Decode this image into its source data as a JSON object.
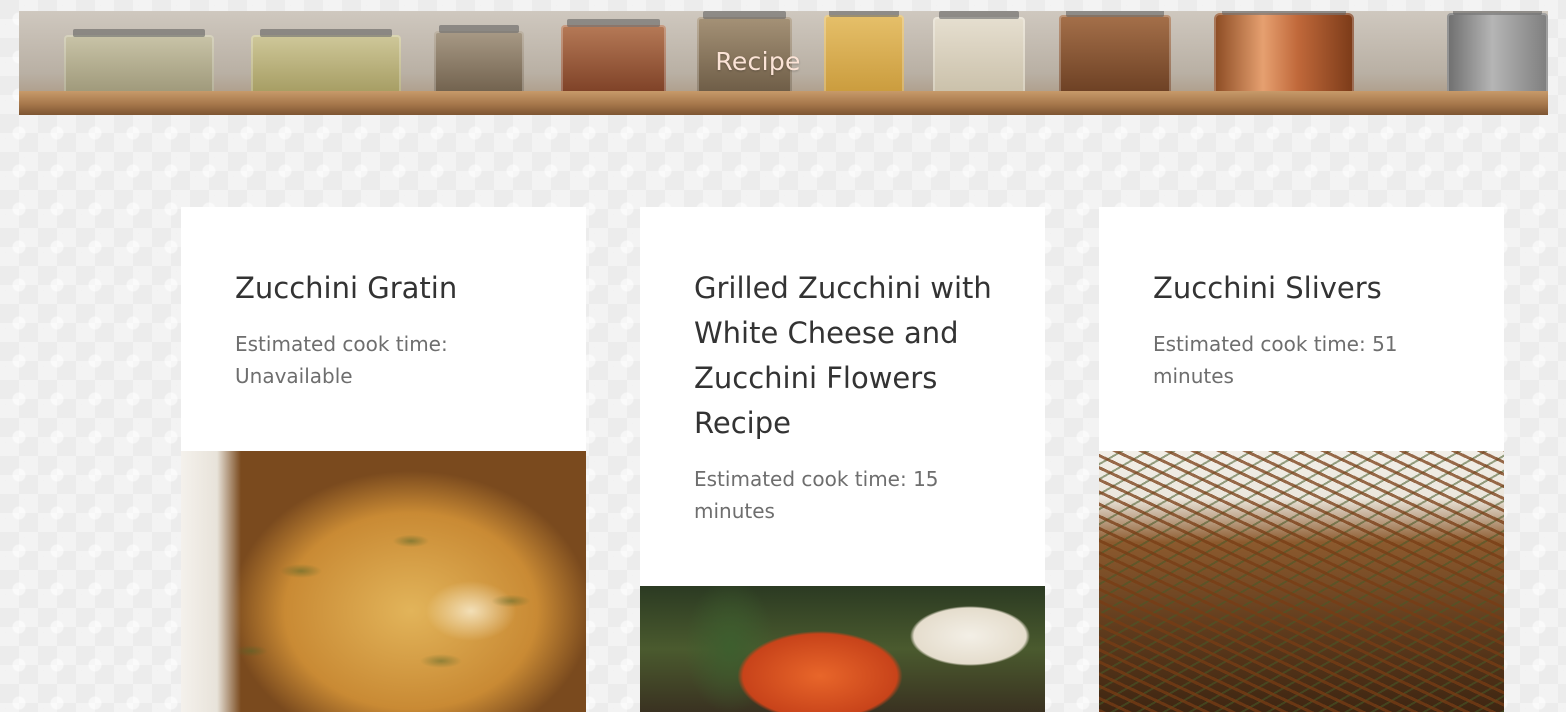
{
  "header": {
    "title": "Recipe"
  },
  "recipes": [
    {
      "title": "Zucchini Gratin",
      "cook_time": "Estimated cook time: Unavailable",
      "image": "zucchini-gratin-photo"
    },
    {
      "title": "Grilled Zucchini with White Cheese and Zucchini Flowers Recipe",
      "cook_time": "Estimated cook time: 15 minutes",
      "image": "grilled-zucchini-photo"
    },
    {
      "title": "Zucchini Slivers",
      "cook_time": "Estimated cook time: 51 minutes",
      "image": "zucchini-slivers-photo"
    }
  ],
  "colors": {
    "page_background": "#ececec",
    "card_background": "#ffffff",
    "title_text": "#333333",
    "meta_text": "#6e6e6e",
    "banner_title": "#fbe3d6"
  }
}
